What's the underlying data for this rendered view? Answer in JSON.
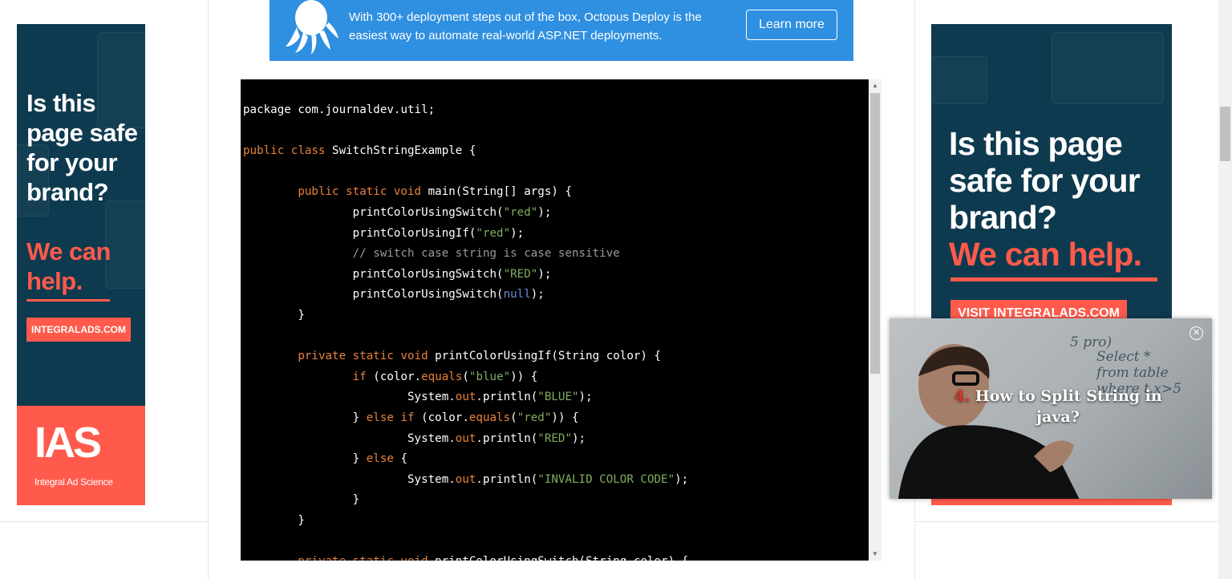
{
  "banner": {
    "text": "With 300+ deployment steps out of the box, Octopus Deploy is the easiest way to automate real-world ASP.NET deployments.",
    "button_label": "Learn more",
    "color": "#2f8fe0"
  },
  "ad_left": {
    "headline": "Is this page safe for your brand?",
    "headline_accent": "We can help.",
    "cta": "INTEGRALADS.COM",
    "logo": "IAS",
    "brand_name": "Integral Ad Science",
    "accent_color": "#ff5a4b",
    "bg_color": "#0e3a4f"
  },
  "ad_right": {
    "headline": "Is this page safe for your brand?",
    "headline_accent": "We can help.",
    "cta": "VISIT INTEGRALADS.COM"
  },
  "code": {
    "language": "java",
    "lines": [
      "package com.journaldev.util;",
      "",
      "public class SwitchStringExample {",
      "",
      "        public static void main(String[] args) {",
      "                printColorUsingSwitch(\"red\");",
      "                printColorUsingIf(\"red\");",
      "                // switch case string is case sensitive",
      "                printColorUsingSwitch(\"RED\");",
      "                printColorUsingSwitch(null);",
      "        }",
      "",
      "        private static void printColorUsingIf(String color) {",
      "                if (color.equals(\"blue\")) {",
      "                        System.out.println(\"BLUE\");",
      "                } else if (color.equals(\"red\")) {",
      "                        System.out.println(\"RED\");",
      "                } else {",
      "                        System.out.println(\"INVALID COLOR CODE\");",
      "                }",
      "        }",
      "",
      "        private static void printColorUsingSwitch(String color) {"
    ]
  },
  "video": {
    "number": "4.",
    "title": "How to Split String in java?",
    "close_icon": "close-circle-icon"
  }
}
